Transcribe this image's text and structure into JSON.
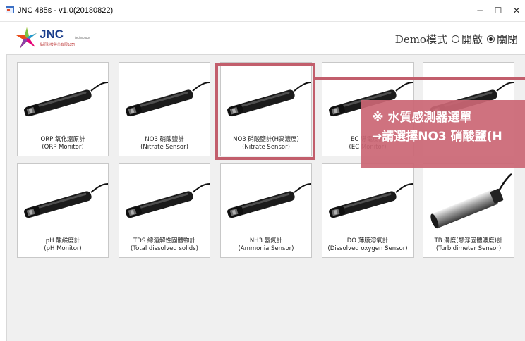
{
  "window": {
    "title": "JNC 485s - v1.0(20180822)",
    "minimize": "−",
    "maximize": "☐",
    "close": "✕"
  },
  "logo": {
    "text": "JNC",
    "tagline": "technology",
    "company": "晶研科技股份有限公司"
  },
  "demo": {
    "label": "Demo模式",
    "options": [
      {
        "label": "開啟",
        "selected": false
      },
      {
        "label": "關閉",
        "selected": true
      }
    ]
  },
  "sensors": [
    {
      "name": "ORP 氧化還原計",
      "sub": "(ORP Monitor)",
      "icon": "probe-icon"
    },
    {
      "name": "NO3 硝酸鹽計",
      "sub": "(Nitrate Sensor)",
      "icon": "probe-icon"
    },
    {
      "name": "NO3 硝酸鹽計(H高濃度)",
      "sub": "(Nitrate Sensor)",
      "icon": "probe-icon"
    },
    {
      "name": "EC 導電度計",
      "sub": "(EC Monitor)",
      "icon": "probe-icon"
    },
    {
      "name": "",
      "sub": "",
      "icon": "probe-icon"
    },
    {
      "name": "pH 酸鹼度計",
      "sub": "(pH Monitor)",
      "icon": "probe-icon"
    },
    {
      "name": "TDS 總溶解性固體物計",
      "sub": "(Total dissolved solids)",
      "icon": "probe-icon"
    },
    {
      "name": "NH3 氨氮計",
      "sub": "(Ammonia Sensor)",
      "icon": "probe-icon"
    },
    {
      "name": "DO 薄膜溶氧計",
      "sub": "(Dissolved oxygen Sensor)",
      "icon": "probe-icon"
    },
    {
      "name": "TB 濁度(懸浮固體濃度)計",
      "sub": "(Turbidimeter Sensor)",
      "icon": "turbidity-probe-icon"
    }
  ],
  "callout": {
    "line1": "※ 水質感測器選單",
    "line2": "→請選擇NO3 硝酸鹽(H",
    "color": "#c25e6c"
  }
}
